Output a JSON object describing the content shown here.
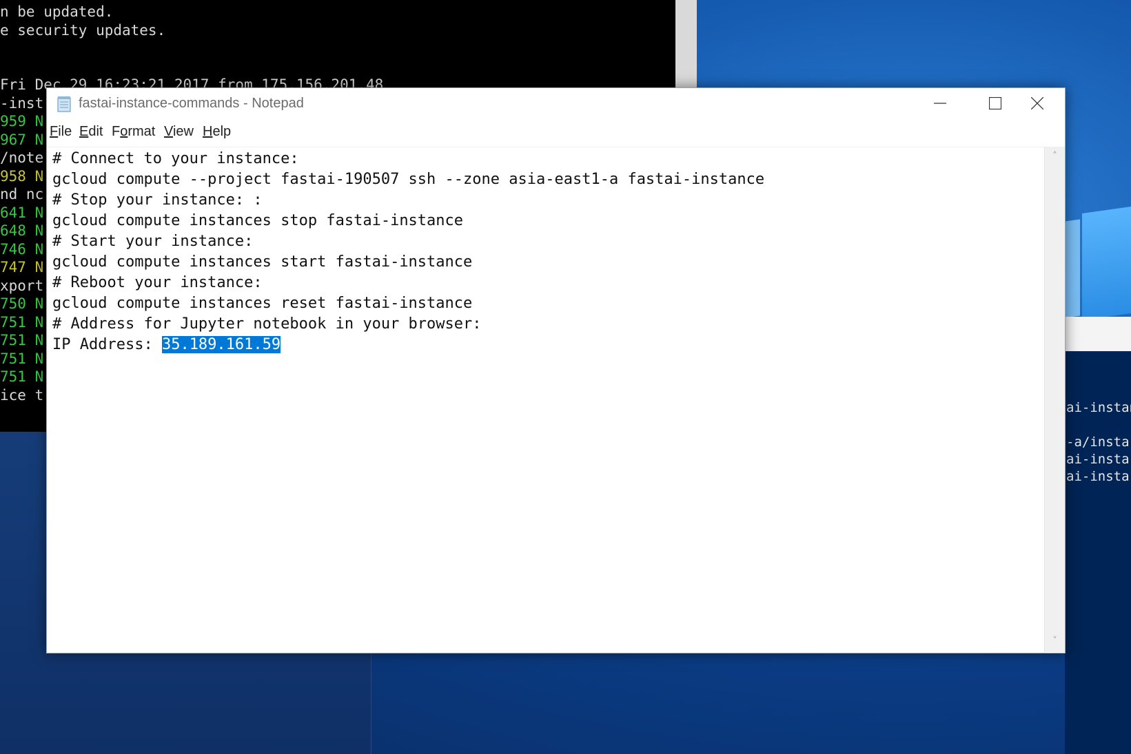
{
  "terminal": {
    "lines": [
      {
        "text": "n be updated.",
        "color": "white"
      },
      {
        "text": "e security updates.",
        "color": "white"
      },
      {
        "text": "",
        "color": "white"
      },
      {
        "text": "",
        "color": "white"
      },
      {
        "text": "Fri Dec 29 16:23:21 2017 from 175.156.201.48",
        "color": "white"
      },
      {
        "text": "-inst",
        "color": "white"
      },
      {
        "text": "959 N",
        "color": "green"
      },
      {
        "text": "967 N",
        "color": "green"
      },
      {
        "text": "/note",
        "color": "white"
      },
      {
        "text": "958 N",
        "color": "yellow"
      },
      {
        "text": "nd nc",
        "color": "white"
      },
      {
        "text": "641 N",
        "color": "green"
      },
      {
        "text": "648 N",
        "color": "green"
      },
      {
        "text": "746 N",
        "color": "green"
      },
      {
        "text": "747 N",
        "color": "yellow"
      },
      {
        "text": "xport",
        "color": "white"
      },
      {
        "text": "750 N",
        "color": "green"
      },
      {
        "text": "751 N",
        "color": "green"
      },
      {
        "text": "751 N",
        "color": "green"
      },
      {
        "text": "751 N",
        "color": "green"
      },
      {
        "text": "751 N",
        "color": "green"
      },
      {
        "text": "ice t",
        "color": "white"
      }
    ]
  },
  "powershell": {
    "lines": [
      "ai-instan",
      "",
      "-a/instar",
      "ai-instar",
      "ai-instar"
    ]
  },
  "notepad": {
    "title": "fastai-instance-commands - Notepad",
    "menu": [
      {
        "label": "File",
        "mnemonic": "F",
        "rest": "ile"
      },
      {
        "label": "Edit",
        "mnemonic": "E",
        "rest": "dit"
      },
      {
        "label": "Format",
        "mnemonic": "o",
        "pre": "F",
        "rest": "rmat"
      },
      {
        "label": "View",
        "mnemonic": "V",
        "rest": "iew"
      },
      {
        "label": "Help",
        "mnemonic": "H",
        "rest": "elp"
      }
    ],
    "lines": [
      "# Connect to your instance:",
      "gcloud compute --project fastai-190507 ssh --zone asia-east1-a fastai-instance",
      "# Stop your instance: :",
      "gcloud compute instances stop fastai-instance",
      "# Start your instance:",
      "gcloud compute instances start fastai-instance",
      "# Reboot your instance:",
      "gcloud compute instances reset fastai-instance",
      "# Address for Jupyter notebook in your browser:"
    ],
    "ip_label": "IP Address: ",
    "ip_value": "35.189.161.59"
  },
  "colors": {
    "selection": "#0078d7",
    "terminal_green": "#39c844",
    "terminal_yellow": "#c8c436"
  }
}
